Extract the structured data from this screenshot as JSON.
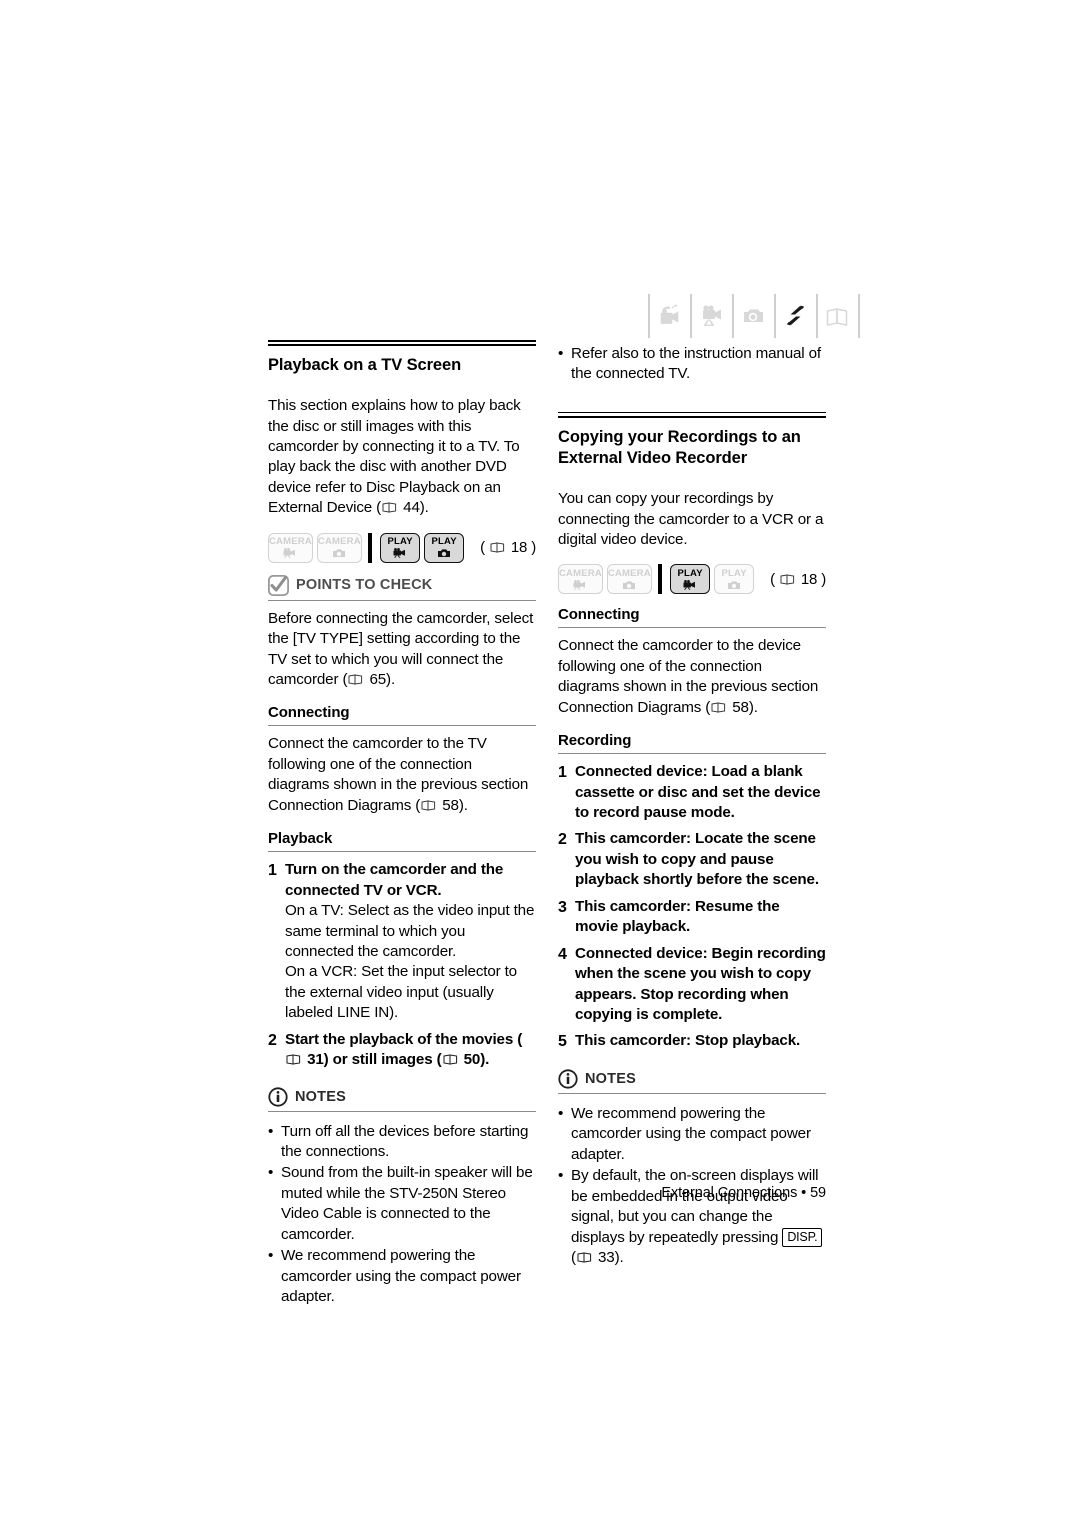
{
  "header": {
    "icons": [
      {
        "name": "camcorder-icon",
        "state": "inactive"
      },
      {
        "name": "movie-camera-icon",
        "state": "inactive"
      },
      {
        "name": "still-camera-icon",
        "state": "inactive"
      },
      {
        "name": "exchange-arrows-icon",
        "state": "active"
      },
      {
        "name": "book-icon",
        "state": "inactive"
      }
    ]
  },
  "left_column": {
    "section_title": "Playback on a TV Screen",
    "intro": "This section explains how to play back the disc or still images with this camcorder by connecting it to a TV. To play back the disc with another DVD device refer to Disc Playback on an External Device (  44).",
    "mode_strip": {
      "badges": [
        {
          "label": "CAMERA",
          "mode": "movie",
          "state": "inactive"
        },
        {
          "label": "CAMERA",
          "mode": "still",
          "state": "inactive"
        },
        {
          "label": "PLAY",
          "mode": "movie",
          "state": "active"
        },
        {
          "label": "PLAY",
          "mode": "still",
          "state": "active"
        }
      ],
      "page_ref": "18"
    },
    "points_to_check": {
      "title": "POINTS TO CHECK",
      "body": "Before connecting the camcorder, select the [TV TYPE] setting according to the TV set to which you will connect the camcorder (  65)."
    },
    "connecting": {
      "title": "Connecting",
      "body": "Connect the camcorder to the TV following one of the connection diagrams shown in the previous section Connection Diagrams (  58)."
    },
    "playback": {
      "title": "Playback",
      "steps": [
        {
          "num": "1",
          "text": "Turn on the camcorder and the connected TV or VCR.",
          "sub": [
            "On a TV: Select as the video input the same terminal to which you connected the camcorder.",
            "On a VCR: Set the input selector to the external video input (usually labeled LINE IN)."
          ]
        },
        {
          "num": "2",
          "text": "Start the playback of the movies (  31) or still images (  50).",
          "sub": []
        }
      ]
    },
    "notes": {
      "title": "NOTES",
      "items": [
        "Turn off all the devices before starting the connections.",
        "Sound from the built-in speaker will be muted while the STV-250N Stereo Video Cable is connected to the camcorder.",
        "We recommend powering the camcorder using the compact power adapter."
      ]
    }
  },
  "right_column": {
    "top_bullet": "Refer also to the instruction manual of the connected TV.",
    "section_title": "Copying your Recordings to an External Video Recorder",
    "intro": "You can copy your recordings by connecting the camcorder to a VCR or a digital video device.",
    "mode_strip": {
      "badges": [
        {
          "label": "CAMERA",
          "mode": "movie",
          "state": "inactive"
        },
        {
          "label": "CAMERA",
          "mode": "still",
          "state": "inactive"
        },
        {
          "label": "PLAY",
          "mode": "movie",
          "state": "active"
        },
        {
          "label": "PLAY",
          "mode": "still",
          "state": "inactive"
        }
      ],
      "page_ref": "18"
    },
    "connecting": {
      "title": "Connecting",
      "body": "Connect the camcorder to the device following one of the connection diagrams shown in the previous section Connection Diagrams (  58)."
    },
    "recording": {
      "title": "Recording",
      "steps": [
        {
          "num": "1",
          "text": "Connected device: Load a blank cassette or disc and set the device to record pause mode."
        },
        {
          "num": "2",
          "text": "This camcorder: Locate the scene you wish to copy and pause playback shortly before the scene."
        },
        {
          "num": "3",
          "text": "This camcorder: Resume the movie playback."
        },
        {
          "num": "4",
          "text": "Connected device: Begin recording when the scene you wish to copy appears. Stop recording when copying is complete."
        },
        {
          "num": "5",
          "text": "This camcorder: Stop playback."
        }
      ]
    },
    "notes": {
      "title": "NOTES",
      "items": [
        "We recommend powering the camcorder using the compact power adapter.",
        "By default, the on-screen displays will be embedded in the output video signal, but you can change the displays by repeatedly pressing"
      ],
      "disp_key": "DISP.",
      "disp_tail_ref": "33"
    }
  },
  "footer": {
    "text": "External Connections • 59"
  },
  "page_refs": {
    "intro_left": "44",
    "points_to_check": "65",
    "connecting_left": "58",
    "step2_movies": "31",
    "step2_stills": "50",
    "connecting_right": "58",
    "notes_disp": "33"
  },
  "colors": {
    "text": "#000000",
    "rule_gray": "#8a8a8a",
    "badge_inactive": "#cfcfcf",
    "badge_active_fill": "#d9d9d9",
    "icon_gray": "#d5d5d5"
  }
}
